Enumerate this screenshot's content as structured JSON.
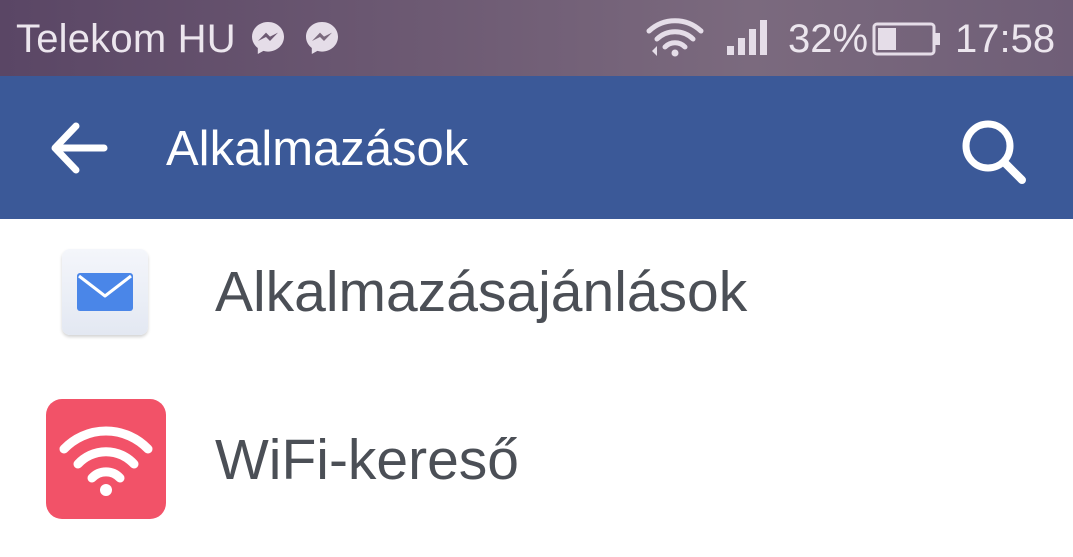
{
  "status_bar": {
    "carrier": "Telekom HU",
    "notification_icons": [
      "messenger-icon",
      "messenger-icon"
    ],
    "wifi_icon": "wifi-icon",
    "signal_icon": "signal-icon",
    "battery_percent": "32%",
    "battery_icon": "battery-icon",
    "time": "17:58",
    "background_color": "#6d5a73"
  },
  "app_bar": {
    "back_icon": "back-arrow-icon",
    "title": "Alkalmazások",
    "search_icon": "search-icon",
    "background_color": "#3b5998"
  },
  "list": {
    "items": [
      {
        "label": "Alkalmazásajánlások",
        "icon": "mail-icon",
        "icon_color": "#4a86e8"
      },
      {
        "label": "WiFi-kereső",
        "icon": "wifi-icon",
        "icon_color": "#f25268"
      }
    ]
  }
}
